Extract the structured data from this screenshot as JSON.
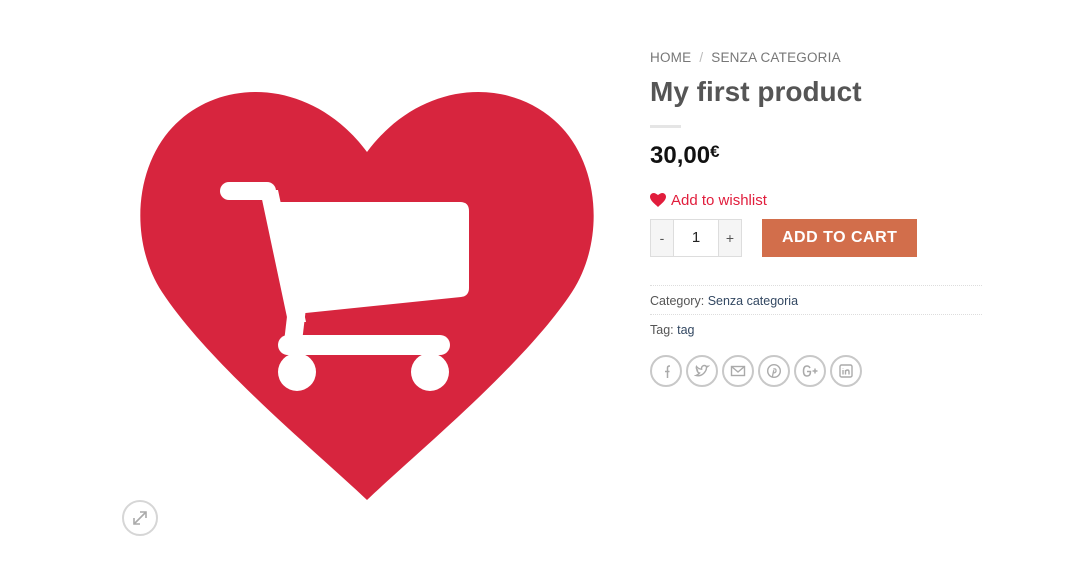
{
  "breadcrumb": {
    "home": "HOME",
    "separator": "/",
    "category": "SENZA CATEGORIA"
  },
  "product": {
    "title": "My first product",
    "price": "30,00",
    "currency": "€",
    "image_icon": "heart-cart-image"
  },
  "wishlist": {
    "label": "Add to wishlist",
    "color": "#e11d3c"
  },
  "quantity": {
    "minus": "-",
    "value": "1",
    "plus": "+"
  },
  "add_to_cart": {
    "label": "ADD TO CART",
    "color": "#d26e4b"
  },
  "meta": {
    "category_label": "Category:",
    "category_value": "Senza categoria",
    "tag_label": "Tag:",
    "tag_value": "tag"
  },
  "share_icons": [
    "facebook-icon",
    "twitter-icon",
    "email-icon",
    "pinterest-icon",
    "google-plus-icon",
    "linkedin-icon"
  ],
  "colors": {
    "heart": "#d7253e",
    "link": "#334862"
  }
}
